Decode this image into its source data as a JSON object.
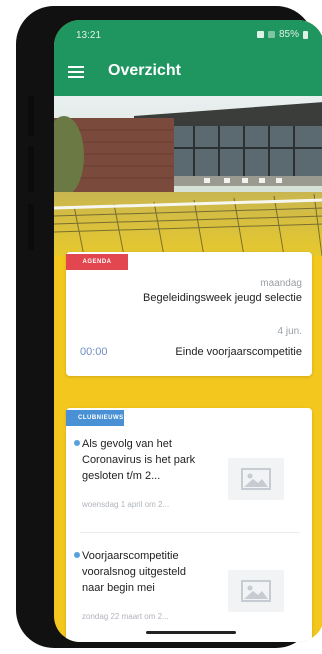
{
  "status": {
    "time": "13:21",
    "battery": "85%"
  },
  "app": {
    "title": "Overzicht"
  },
  "agenda": {
    "badge": "AGENDA",
    "items": [
      {
        "day": "maandag",
        "time": "",
        "title": "Begeleidingsweek jeugd selectie"
      },
      {
        "day": "4 jun.",
        "time": "00:00",
        "title": "Einde voorjaarscompetitie"
      }
    ]
  },
  "news": {
    "badge": "CLUBNIEUWS",
    "items": [
      {
        "text": "Als gevolg van het Coronavirus is het park gesloten t/m 2...",
        "meta": "woensdag 1 april om 2..."
      },
      {
        "text": "Voorjaarscompetitie vooralsnog uitgesteld naar begin mei",
        "meta": "zondag 22 maart om 2..."
      }
    ]
  },
  "colors": {
    "primary": "#1f9660",
    "accent_yellow": "#f3c71d",
    "agenda_red": "#e2464f",
    "news_blue": "#4a90d4"
  },
  "icons": [
    "menu-icon",
    "image-placeholder-icon"
  ]
}
